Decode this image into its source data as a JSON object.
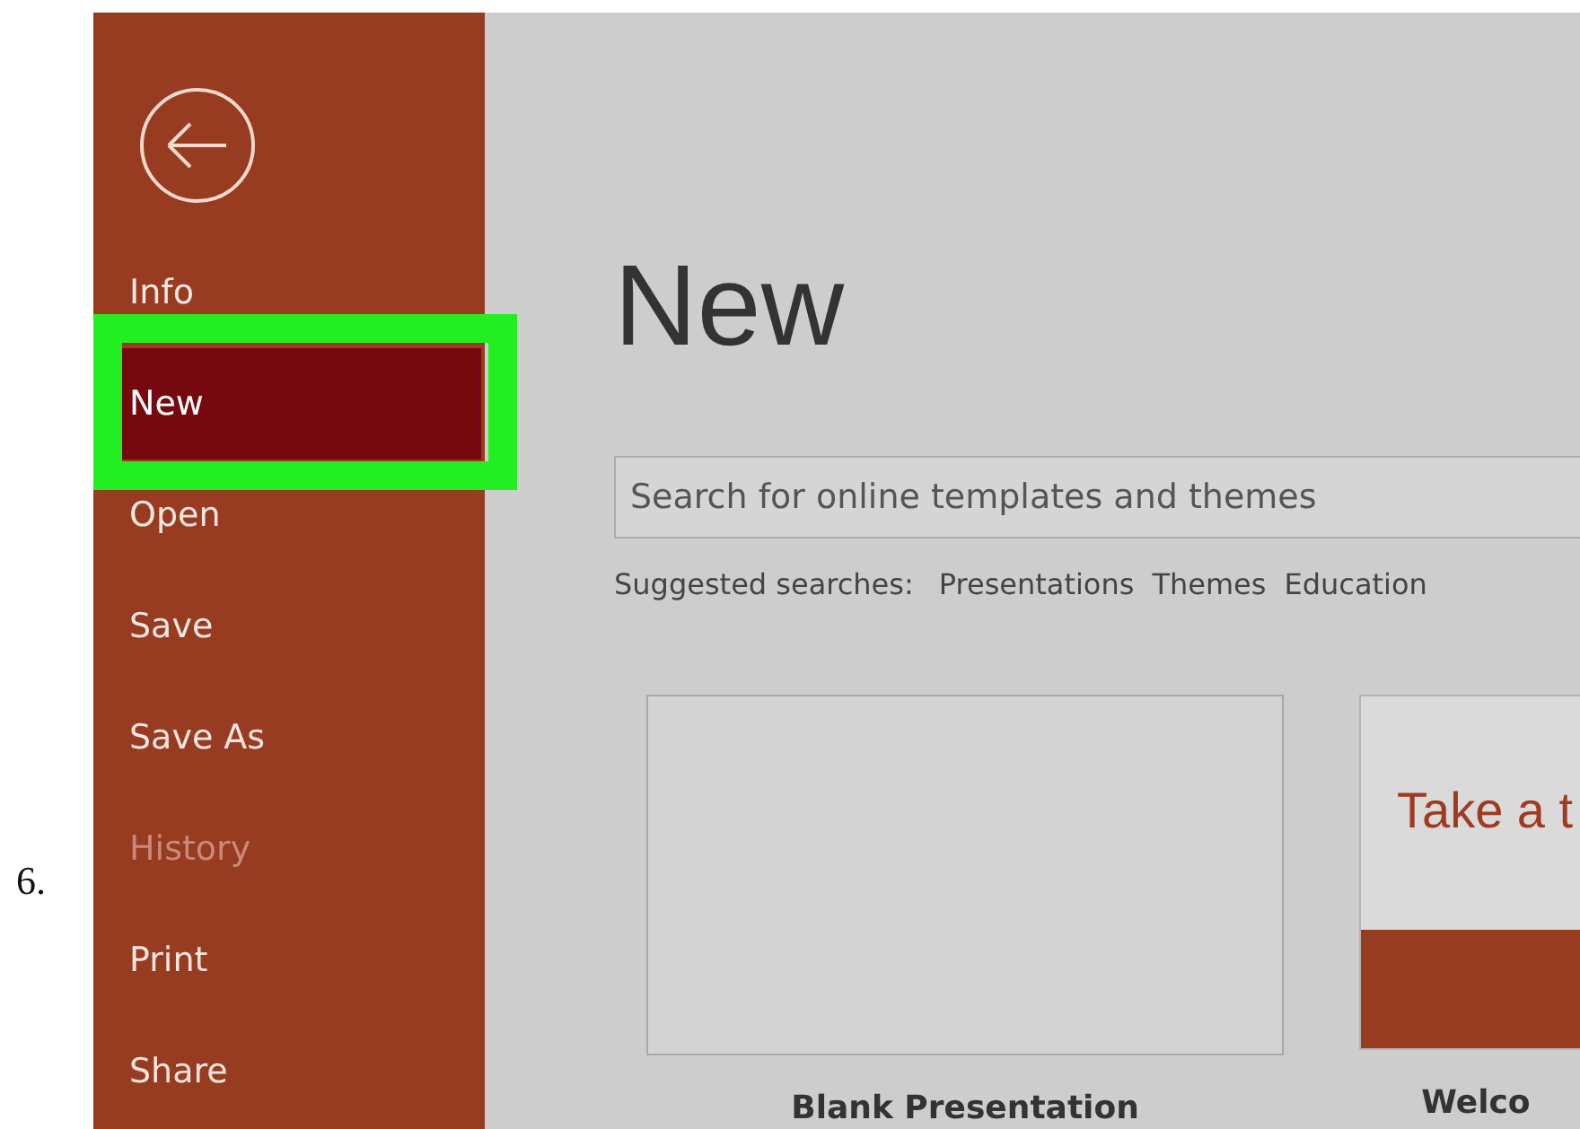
{
  "step_number": "6.",
  "sidebar": {
    "items": [
      {
        "label": "Info",
        "selected": false,
        "disabled": false,
        "highlighted": false
      },
      {
        "label": "New",
        "selected": true,
        "disabled": false,
        "highlighted": true
      },
      {
        "label": "Open",
        "selected": false,
        "disabled": false,
        "highlighted": false
      },
      {
        "label": "Save",
        "selected": false,
        "disabled": false,
        "highlighted": false
      },
      {
        "label": "Save As",
        "selected": false,
        "disabled": false,
        "highlighted": false
      },
      {
        "label": "History",
        "selected": false,
        "disabled": true,
        "highlighted": false
      },
      {
        "label": "Print",
        "selected": false,
        "disabled": false,
        "highlighted": false
      },
      {
        "label": "Share",
        "selected": false,
        "disabled": false,
        "highlighted": false
      }
    ]
  },
  "main": {
    "title": "New",
    "search": {
      "placeholder": "Search for online templates and themes"
    },
    "suggested": {
      "label": "Suggested searches:",
      "links": [
        "Presentations",
        "Themes",
        "Education"
      ]
    },
    "templates": [
      {
        "kind": "blank",
        "label": "Blank Presentation"
      },
      {
        "kind": "tour",
        "heading": "Take a t",
        "label": "Welco"
      }
    ]
  }
}
